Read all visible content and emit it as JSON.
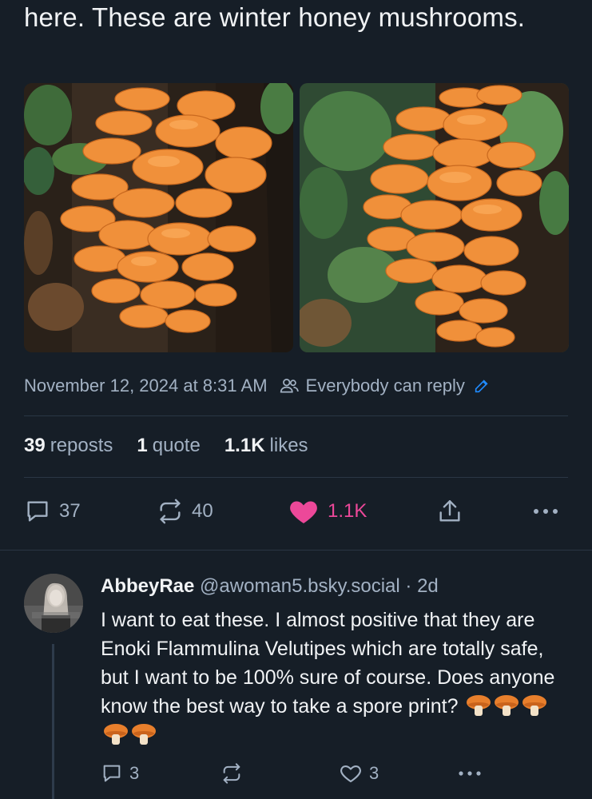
{
  "post": {
    "text_tail": "here. These are winter honey mushrooms.",
    "timestamp": "November 12, 2024 at 8:31 AM",
    "reply_setting": "Everybody can reply",
    "stats": {
      "reposts_count": "39",
      "reposts_label": "reposts",
      "quotes_count": "1",
      "quotes_label": "quote",
      "likes_count": "1.1K",
      "likes_label": "likes"
    },
    "actions": {
      "reply_count": "37",
      "repost_count": "40",
      "like_count": "1.1K",
      "liked": true
    },
    "images": [
      {
        "icon": "mushroom-cluster-photo-1"
      },
      {
        "icon": "mushroom-cluster-photo-2"
      }
    ]
  },
  "reply": {
    "display_name": "AbbeyRae",
    "handle": "@awoman5.bsky.social",
    "separator": "·",
    "age": "2d",
    "text": "I want to eat these. I almost positive that they are Enoki Flammulina Velutipes which are totally safe, but I want to be 100% sure of course. Does anyone know the best way to take a spore print?",
    "emoji": [
      "mushroom-emoji",
      "mushroom-emoji",
      "mushroom-emoji",
      "mushroom-emoji",
      "mushroom-emoji"
    ],
    "actions": {
      "reply_count": "3",
      "repost_count": "",
      "like_count": "3"
    }
  },
  "colors": {
    "background": "#161e27",
    "text_primary": "#f1f3f5",
    "text_secondary": "#a2b1c3",
    "like_pink": "#ec4899",
    "accent_blue": "#208bfe",
    "mushroom_orange": "#f2923a"
  }
}
